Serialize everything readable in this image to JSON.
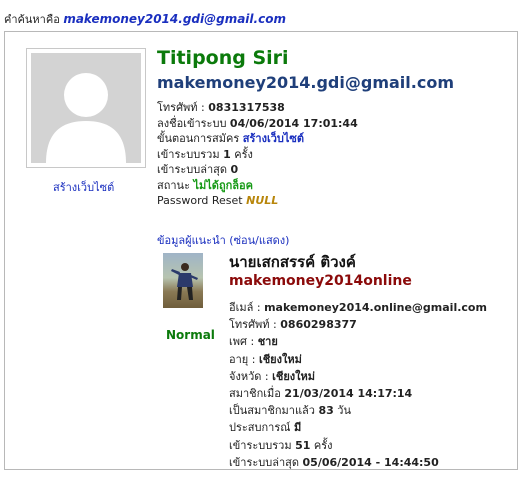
{
  "search": {
    "label": "คำค้นหาคือ",
    "query": "makemoney2014.gdi@gmail.com"
  },
  "profile": {
    "name": "Titipong Siri",
    "email": "makemoney2014.gdi@gmail.com",
    "create_site_link": "สร้างเว็บไซต์",
    "rows": {
      "phone_label": "โทรศัพท์ :",
      "phone_value": "0831317538",
      "registered_label": "ลงชื่อเข้าระบบ",
      "registered_value": "04/06/2014 17:01:44",
      "step_label": "ขั้นตอนการสมัคร",
      "step_value": "สร้างเว็บไซต์",
      "logins_label": "เข้าระบบรวม",
      "logins_value": "1",
      "logins_unit": "ครั้ง",
      "last_login_label": "เข้าระบบล่าสุด",
      "last_login_value": "0",
      "status_label": "สถานะ",
      "status_value": "ไม่ได้ถูกล็อค",
      "reset_label": "Password Reset",
      "reset_value": "NULL"
    }
  },
  "referrer": {
    "toggle_link": "ข้อมูลผู้แนะนำ (ซ่อน/แสดง)",
    "badge": "Normal",
    "name": "นายเสกสรรค์ ติวงค์",
    "username": "makemoney2014online",
    "rows": {
      "email_label": "อีเมล์ :",
      "email_value": "makemoney2014.online@gmail.com",
      "phone_label": "โทรศัพท์ :",
      "phone_value": "0860298377",
      "gender_label": "เพศ :",
      "gender_value": "ชาย",
      "age_label": "อายุ :",
      "age_value": "เชียงใหม่",
      "province_label": "จังหวัด :",
      "province_value": "เชียงใหม่",
      "member_since_label": "สมาชิกเมื่อ",
      "member_since_value": "21/03/2014 14:17:14",
      "member_days_label": "เป็นสมาชิกมาแล้ว",
      "member_days_value": "83",
      "member_days_unit": "วัน",
      "experience_label": "ประสบการณ์",
      "experience_value": "มี",
      "logins_label": "เข้าระบบรวม",
      "logins_value": "51",
      "logins_unit": "ครั้ง",
      "last_login_label": "เข้าระบบล่าสุด",
      "last_login_value": "05/06/2014 - 14:44:50"
    }
  }
}
